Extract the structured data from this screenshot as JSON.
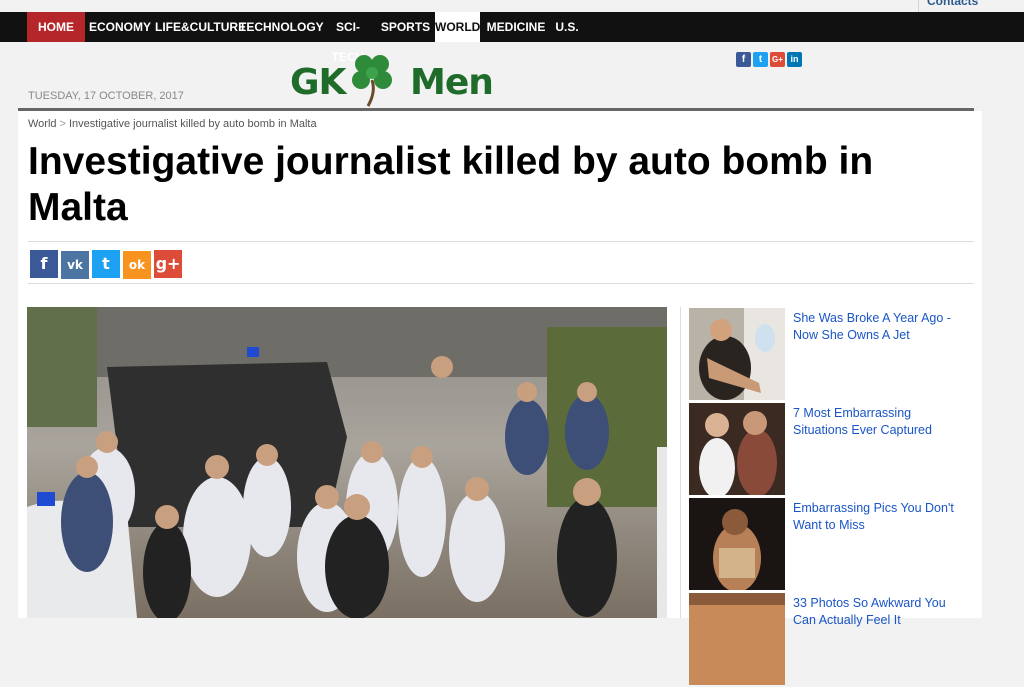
{
  "top_links": {
    "contacts": "Contacts"
  },
  "nav": {
    "items": [
      {
        "label": "HOME",
        "key": "home"
      },
      {
        "label": "ECONOMY",
        "key": "economy"
      },
      {
        "label": "LIFE&CULTURE",
        "key": "lifeculture"
      },
      {
        "label": "TECHNOLOGY",
        "key": "technology"
      },
      {
        "label": "SCI-TECH",
        "key": "scitech"
      },
      {
        "label": "SPORTS",
        "key": "sports"
      },
      {
        "label": "WORLD",
        "key": "world",
        "active": true
      },
      {
        "label": "MEDICINE",
        "key": "medicine"
      },
      {
        "label": "U.S.",
        "key": "us"
      }
    ]
  },
  "header": {
    "date": "TUESDAY, 17 OCTOBER, 2017",
    "logo_left": "GK",
    "logo_right": "Men",
    "social": [
      {
        "name": "facebook-icon",
        "glyph": "f",
        "color": "#3b5998"
      },
      {
        "name": "twitter-icon",
        "glyph": "t",
        "color": "#1da1f2"
      },
      {
        "name": "google-plus-icon",
        "glyph": "G+",
        "color": "#dd4b39"
      },
      {
        "name": "linkedin-icon",
        "glyph": "in",
        "color": "#0077b5"
      }
    ]
  },
  "breadcrumb": {
    "section": "World",
    "separator": ">",
    "current": "Investigative journalist killed by auto bomb in Malta"
  },
  "article": {
    "title": "Investigative journalist killed by auto bomb in Malta"
  },
  "share": [
    {
      "name": "facebook-share-icon",
      "glyph": "f",
      "color": "#3b5998"
    },
    {
      "name": "vk-share-icon",
      "glyph": "vk",
      "color": "#4c75a3"
    },
    {
      "name": "twitter-share-icon",
      "glyph": "t",
      "color": "#1da1f2"
    },
    {
      "name": "odnoklassniki-share-icon",
      "glyph": "ok",
      "color": "#f7931e"
    },
    {
      "name": "google-plus-share-icon",
      "glyph": "g+",
      "color": "#dd4b39"
    }
  ],
  "sidebar": {
    "items": [
      {
        "title": "She Was Broke A Year Ago - Now She Owns A Jet"
      },
      {
        "title": "7 Most Embarrassing Situations Ever Captured"
      },
      {
        "title": "Embarrassing Pics You Don't Want to Miss"
      },
      {
        "title": "33 Photos So Awkward You Can Actually Feel It"
      }
    ]
  }
}
